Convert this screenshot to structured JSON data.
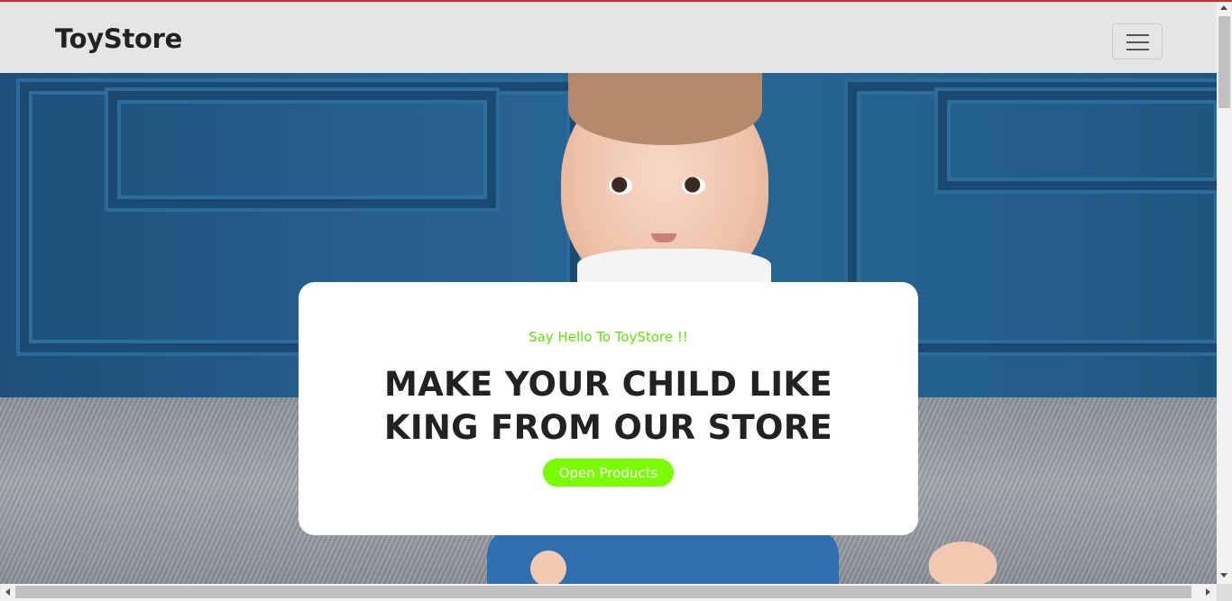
{
  "navbar": {
    "brand": "ToyStore",
    "toggler_icon": "hamburger-menu-icon"
  },
  "hero": {
    "image": "baby-sitting-on-rug-photo",
    "tagline": "Say Hello To ToyStore !!",
    "headline": "MAKE YOUR CHILD LIKE KING FROM OUR STORE",
    "cta_label": "Open Products"
  },
  "colors": {
    "accent": "#7cfc00",
    "tagline": "#66dd11",
    "navbar_bg": "#e5e5e5",
    "top_line": "#c9302c"
  }
}
